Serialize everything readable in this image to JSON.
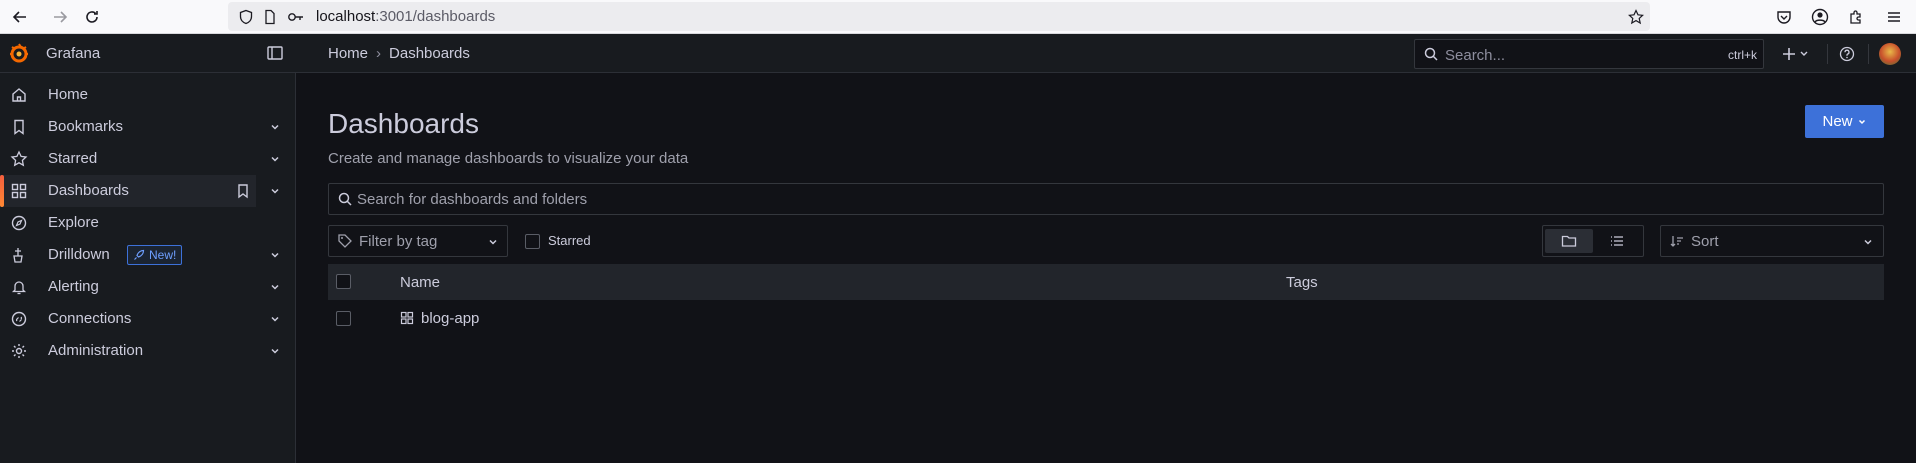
{
  "browser": {
    "url_host": "localhost",
    "url_path": ":3001/dashboards"
  },
  "app": {
    "brand": "Grafana",
    "accent_color": "#f55f3e",
    "primary_color": "#3d71d9"
  },
  "sidebar": {
    "items": [
      {
        "label": "Home",
        "icon": "home-icon",
        "has_chevron": false
      },
      {
        "label": "Bookmarks",
        "icon": "bookmark-icon",
        "has_chevron": true
      },
      {
        "label": "Starred",
        "icon": "star-icon",
        "has_chevron": true
      },
      {
        "label": "Dashboards",
        "icon": "apps-icon",
        "has_chevron": true,
        "active": true
      },
      {
        "label": "Explore",
        "icon": "compass-icon",
        "has_chevron": false
      },
      {
        "label": "Drilldown",
        "icon": "drilldown-icon",
        "has_chevron": true,
        "badge": "New!"
      },
      {
        "label": "Alerting",
        "icon": "bell-icon",
        "has_chevron": true
      },
      {
        "label": "Connections",
        "icon": "connections-icon",
        "has_chevron": true
      },
      {
        "label": "Administration",
        "icon": "cog-icon",
        "has_chevron": true
      }
    ]
  },
  "topbar": {
    "breadcrumb_home": "Home",
    "breadcrumb_sep": "›",
    "breadcrumb_current": "Dashboards",
    "search_placeholder": "Search...",
    "search_shortcut": "ctrl+k"
  },
  "main": {
    "title": "Dashboards",
    "subtitle": "Create and manage dashboards to visualize your data",
    "new_button": "New",
    "search_placeholder": "Search for dashboards and folders",
    "filter_tag_placeholder": "Filter by tag",
    "starred_label": "Starred",
    "sort_placeholder": "Sort",
    "table": {
      "columns": [
        "Name",
        "Tags"
      ],
      "rows": [
        {
          "name": "blog-app",
          "tags": ""
        }
      ]
    }
  }
}
